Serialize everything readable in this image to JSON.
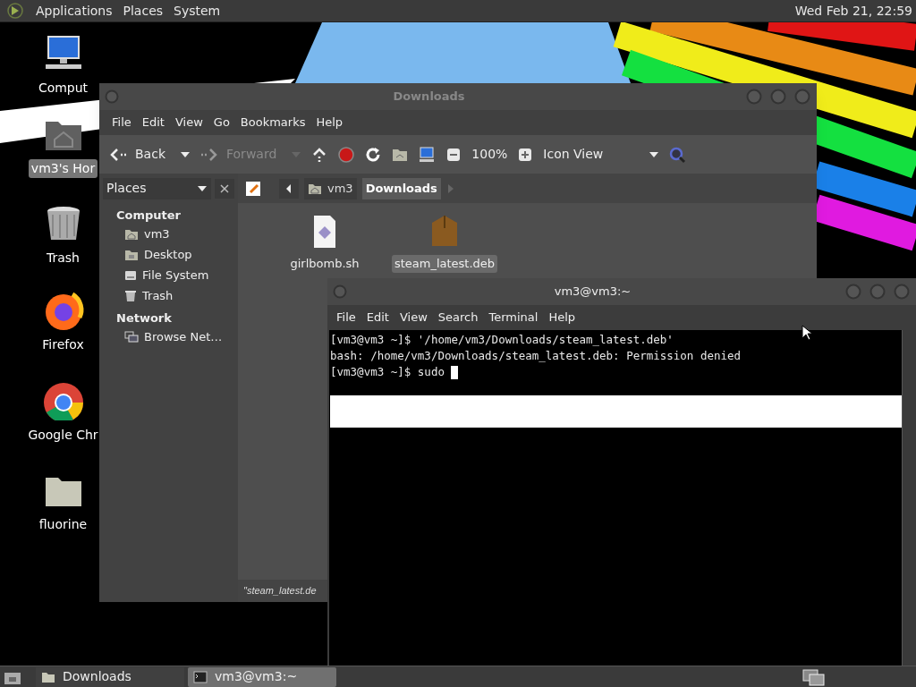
{
  "top_panel": {
    "menus": [
      "Applications",
      "Places",
      "System"
    ],
    "clock": "Wed Feb 21, 22:59"
  },
  "desktop_icons": [
    {
      "kind": "computer",
      "label": "Comput",
      "selected": false
    },
    {
      "kind": "home",
      "label": "vm3's Hor",
      "selected": true
    },
    {
      "kind": "trash",
      "label": "Trash",
      "selected": false
    },
    {
      "kind": "firefox",
      "label": "Firefox",
      "selected": false
    },
    {
      "kind": "chrome",
      "label": "Google Chr",
      "selected": false
    },
    {
      "kind": "folder",
      "label": "fluorine",
      "selected": false
    }
  ],
  "file_manager": {
    "title": "Downloads",
    "menu": [
      "File",
      "Edit",
      "View",
      "Go",
      "Bookmarks",
      "Help"
    ],
    "toolbar": [
      {
        "kind": "back",
        "label": "Back",
        "disabled": false
      },
      {
        "kind": "forward",
        "label": "Forward",
        "disabled": true
      },
      {
        "kind": "up"
      },
      {
        "kind": "stop"
      },
      {
        "kind": "reload"
      },
      {
        "kind": "home"
      },
      {
        "kind": "computer"
      },
      {
        "kind": "zoomout"
      },
      {
        "kind": "zoomlevel",
        "label": "100%"
      },
      {
        "kind": "zoomin"
      },
      {
        "kind": "viewselect",
        "label": "Icon View"
      },
      {
        "kind": "search"
      }
    ],
    "sidebar": {
      "selector": "Places",
      "sections": [
        {
          "heading": "Computer",
          "items": [
            {
              "kind": "home",
              "label": "vm3"
            },
            {
              "kind": "desktop",
              "label": "Desktop"
            },
            {
              "kind": "drive",
              "label": "File System"
            },
            {
              "kind": "trash",
              "label": "Trash"
            }
          ]
        },
        {
          "heading": "Network",
          "items": [
            {
              "kind": "network",
              "label": "Browse Net…"
            }
          ]
        }
      ]
    },
    "path": [
      {
        "label": "vm3",
        "selected": false
      },
      {
        "label": "Downloads",
        "selected": true
      }
    ],
    "files": [
      {
        "kind": "script",
        "name": "girlbomb.sh",
        "selected": false
      },
      {
        "kind": "package",
        "name": "steam_latest.deb",
        "selected": true
      }
    ],
    "status": "\"steam_latest.de"
  },
  "terminal": {
    "title": "vm3@vm3:~",
    "menu": [
      "File",
      "Edit",
      "View",
      "Search",
      "Terminal",
      "Help"
    ],
    "lines": [
      "[vm3@vm3 ~]$ '/home/vm3/Downloads/steam_latest.deb'",
      "bash: /home/vm3/Downloads/steam_latest.deb: Permission denied",
      "[vm3@vm3 ~]$ sudo "
    ]
  },
  "taskbar": [
    {
      "kind": "folder",
      "label": "Downloads",
      "selected": false
    },
    {
      "kind": "terminal",
      "label": "vm3@vm3:~",
      "selected": true
    }
  ]
}
